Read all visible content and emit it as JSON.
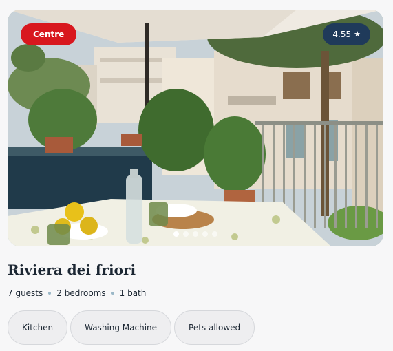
{
  "listing": {
    "location_badge": "Centre",
    "rating": "4.55",
    "rating_icon": "★",
    "title": "Riviera dei friori",
    "guests": "7 guests",
    "bedrooms": "2 bedrooms",
    "baths": "1 bath",
    "amenities": [
      "Kitchen",
      "Washing Machine",
      "Pets allowed"
    ],
    "carousel": {
      "total": 5,
      "active": 1
    }
  },
  "colors": {
    "location_badge": "#d8171e",
    "rating_badge": "#1f3a5a",
    "separator": "#9ab7c7"
  }
}
